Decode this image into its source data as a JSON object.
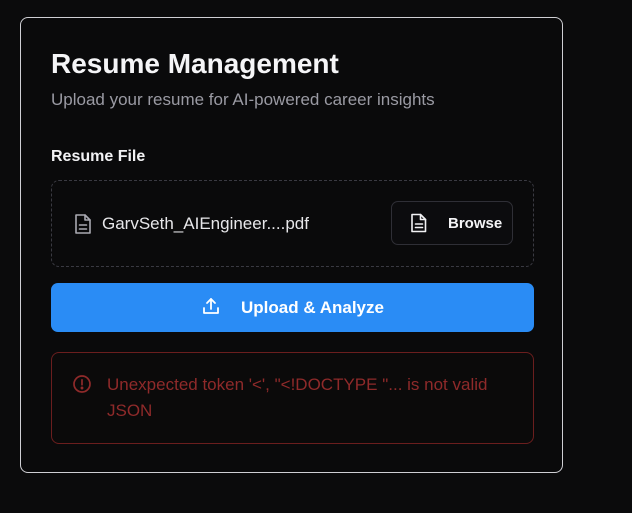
{
  "card": {
    "title": "Resume Management",
    "subtitle": "Upload your resume for AI-powered career insights"
  },
  "file_field": {
    "label": "Resume File",
    "file_name": "GarvSeth_AIEngineer....pdf",
    "browse_label": "Browse"
  },
  "upload_button": {
    "label": "Upload & Analyze"
  },
  "error": {
    "message": "Unexpected token '<', \"<!DOCTYPE \"... is not valid JSON"
  },
  "colors": {
    "background": "#0b0b0c",
    "accent": "#2a8cf5",
    "error": "#8f2a2a"
  },
  "icons": {
    "file": "file-text-icon",
    "upload": "upload-icon",
    "error": "alert-circle-icon"
  }
}
